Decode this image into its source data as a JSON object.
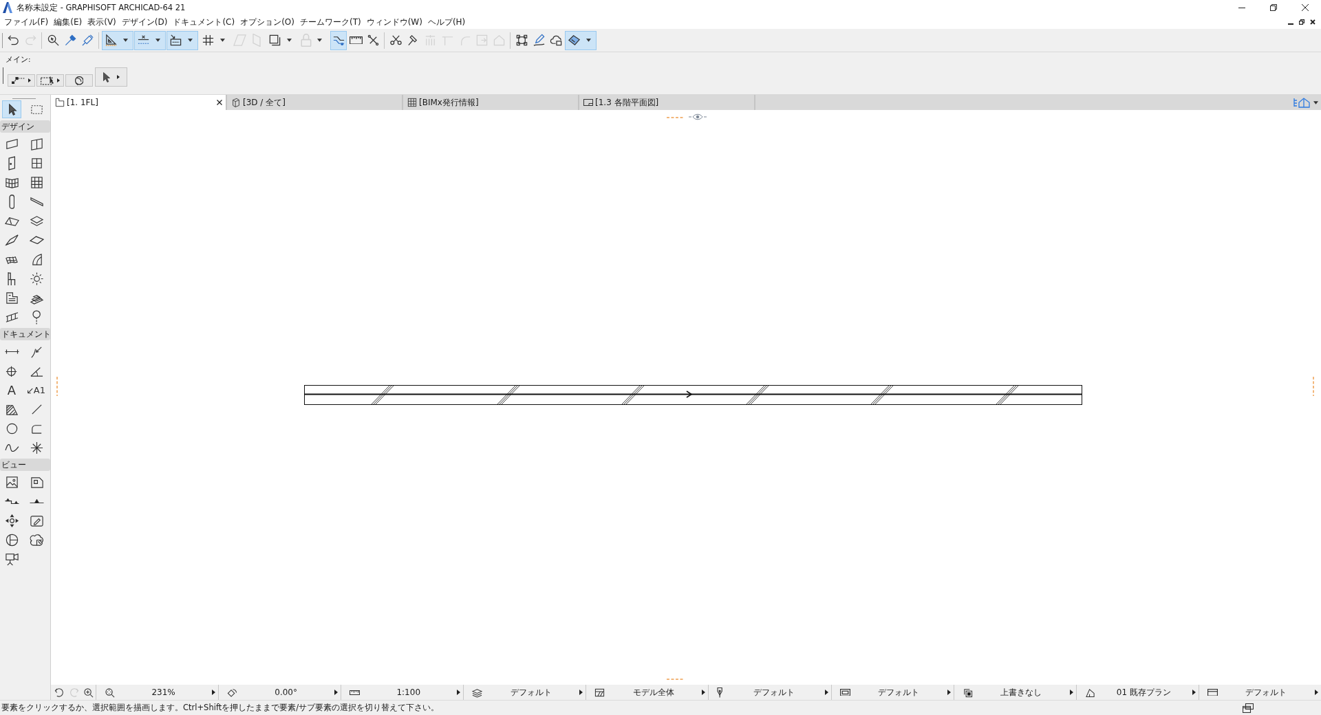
{
  "window": {
    "title": "名称未設定 - GRAPHISOFT ARCHICAD-64 21"
  },
  "menu_bar": {
    "items": [
      "ファイル(F)",
      "編集(E)",
      "表示(V)",
      "デザイン(D)",
      "ドキュメント(C)",
      "オプション(O)",
      "チームワーク(T)",
      "ウィンドウ(W)",
      "ヘルプ(H)"
    ]
  },
  "toolbar": {
    "groups": [
      [
        {
          "on": false,
          "disabled": false,
          "dropdown": false
        },
        {
          "on": false,
          "disabled": true,
          "dropdown": false
        }
      ],
      [
        {
          "on": false,
          "disabled": false,
          "dropdown": false
        },
        {
          "on": false,
          "disabled": false,
          "dropdown": false
        },
        {
          "on": false,
          "disabled": false,
          "dropdown": false
        }
      ],
      [
        {
          "on": true,
          "disabled": false,
          "dropdown": true
        },
        {
          "on": true,
          "disabled": false,
          "dropdown": true
        },
        {
          "on": true,
          "disabled": false,
          "dropdown": true
        },
        {
          "on": false,
          "disabled": false,
          "dropdown": true
        },
        {
          "on": false,
          "disabled": true,
          "dropdown": false
        },
        {
          "on": false,
          "disabled": true,
          "dropdown": false
        },
        {
          "on": false,
          "disabled": false,
          "dropdown": true
        },
        {
          "on": false,
          "disabled": true,
          "dropdown": true
        },
        {
          "on": true,
          "disabled": false,
          "dropdown": false
        },
        {
          "on": false,
          "disabled": false,
          "dropdown": false
        },
        {
          "on": false,
          "disabled": false,
          "dropdown": false
        }
      ],
      [
        {
          "on": false,
          "disabled": false,
          "dropdown": false
        },
        {
          "on": false,
          "disabled": false,
          "dropdown": false
        },
        {
          "on": false,
          "disabled": true,
          "dropdown": false
        },
        {
          "on": false,
          "disabled": true,
          "dropdown": false
        },
        {
          "on": false,
          "disabled": true,
          "dropdown": false
        },
        {
          "on": false,
          "disabled": true,
          "dropdown": false
        },
        {
          "on": false,
          "disabled": true,
          "dropdown": false
        }
      ],
      [
        {
          "on": false,
          "disabled": false,
          "dropdown": false
        },
        {
          "on": false,
          "disabled": false,
          "dropdown": false
        },
        {
          "on": false,
          "disabled": false,
          "dropdown": false
        },
        {
          "on": true,
          "disabled": false,
          "dropdown": true
        }
      ]
    ]
  },
  "info_box": {
    "label": "メイン:"
  },
  "tabs": [
    {
      "kind": "plan",
      "label": "[1. 1FL]",
      "selected": true
    },
    {
      "kind": "model",
      "label": "[3D / 全て]",
      "selected": false
    },
    {
      "kind": "schedule",
      "label": "[BIMx発行情報]",
      "selected": false
    },
    {
      "kind": "layout",
      "label": "[1.3 各階平面図]",
      "selected": false
    }
  ],
  "toolbox": {
    "sections": [
      {
        "tools": [
          {
            "selected": true
          },
          {
            "selected": false
          }
        ]
      },
      {
        "title": "デザイン",
        "tools": [
          {
            "selected": false
          },
          {
            "selected": false
          },
          {
            "selected": false
          },
          {
            "selected": false
          },
          {
            "selected": false
          },
          {
            "selected": false
          },
          {
            "selected": false
          },
          {
            "selected": false
          },
          {
            "selected": false
          },
          {
            "selected": false
          },
          {
            "selected": false
          },
          {
            "selected": false
          },
          {
            "selected": false
          },
          {
            "selected": false
          },
          {
            "selected": false
          },
          {
            "selected": false
          },
          {
            "selected": false
          },
          {
            "selected": false
          },
          {
            "selected": false
          },
          {
            "selected": false
          }
        ]
      },
      {
        "title": "ドキュメント",
        "tools": [
          {
            "selected": false
          },
          {
            "selected": false
          },
          {
            "selected": false
          },
          {
            "selected": false
          },
          {
            "selected": false,
            "glyph": "A"
          },
          {
            "selected": false,
            "glyph": "A1"
          },
          {
            "selected": false
          },
          {
            "selected": false
          },
          {
            "selected": false
          },
          {
            "selected": false
          },
          {
            "selected": false
          },
          {
            "selected": false
          }
        ]
      },
      {
        "title": "ビュー",
        "tools": [
          {
            "selected": false
          },
          {
            "selected": false
          },
          {
            "selected": false
          },
          {
            "selected": false
          },
          {
            "selected": false
          },
          {
            "selected": false
          },
          {
            "selected": false
          },
          {
            "selected": false
          },
          {
            "selected": false
          }
        ]
      }
    ]
  },
  "status_bar": {
    "navigation": [
      {
        "disabled": false
      },
      {
        "disabled": true
      },
      {
        "disabled": false
      }
    ],
    "fields": [
      "231%",
      "0.00°",
      "1:100",
      "デフォルト",
      "モデル全体",
      "デフォルト",
      "デフォルト",
      "上書きなし",
      "01 既存プラン",
      "デフォルト"
    ]
  },
  "message": "要素をクリックするか、選択範囲を描画します。Ctrl+Shiftを押したままで要素/サブ要素の選択を切り替えて下さい。"
}
